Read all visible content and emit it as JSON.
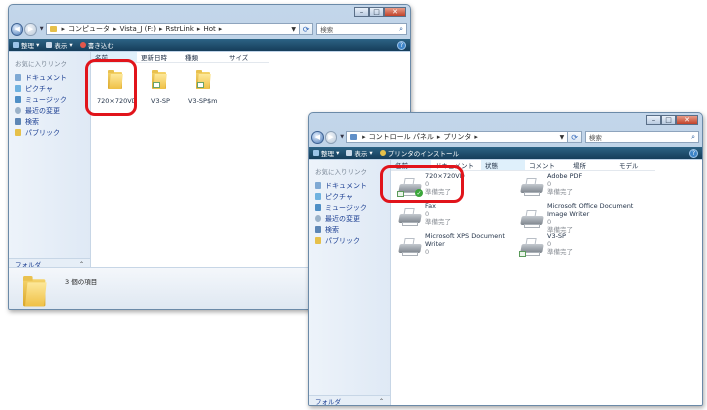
{
  "window1": {
    "breadcrumb": [
      "コンピュータ",
      "Vista_J (F:)",
      "RstrLink",
      "Hot"
    ],
    "search_placeholder": "検索",
    "toolbar": [
      "整理",
      "表示",
      "書き込む"
    ],
    "favorites_header": "お気に入りリンク",
    "favorites": [
      {
        "label": "ドキュメント",
        "icon": "documents-icon"
      },
      {
        "label": "ピクチャ",
        "icon": "pictures-icon"
      },
      {
        "label": "ミュージック",
        "icon": "music-icon"
      },
      {
        "label": "最近の変更",
        "icon": "recent-icon"
      },
      {
        "label": "検索",
        "icon": "search-folder-icon"
      },
      {
        "label": "パブリック",
        "icon": "public-folder-icon"
      }
    ],
    "folders_label": "フォルダ",
    "columns": [
      "名前",
      "更新日時",
      "種類",
      "サイズ"
    ],
    "items": [
      "720×720VD",
      "V3-SP",
      "V3-SP$m"
    ],
    "status": "3 個の項目",
    "accent": "#e1141b"
  },
  "window2": {
    "breadcrumb": [
      "コントロール パネル",
      "プリンタ"
    ],
    "search_placeholder": "検索",
    "toolbar": [
      "整理",
      "表示",
      "プリンタのインストール"
    ],
    "favorites_header": "お気に入りリンク",
    "favorites": [
      {
        "label": "ドキュメント",
        "icon": "documents-icon"
      },
      {
        "label": "ピクチャ",
        "icon": "pictures-icon"
      },
      {
        "label": "ミュージック",
        "icon": "music-icon"
      },
      {
        "label": "最近の変更",
        "icon": "recent-icon"
      },
      {
        "label": "検索",
        "icon": "search-folder-icon"
      },
      {
        "label": "パブリック",
        "icon": "public-folder-icon"
      }
    ],
    "folders_label": "フォルダ",
    "columns": [
      "名前",
      "ドキュメント",
      "状態",
      "コメント",
      "場所",
      "モデル"
    ],
    "printers": [
      {
        "name": "720×720VD",
        "line2": "",
        "count": "0",
        "status": "準備完了"
      },
      {
        "name": "Adobe PDF",
        "line2": "",
        "count": "0",
        "status": "準備完了"
      },
      {
        "name": "Fax",
        "line2": "",
        "count": "0",
        "status": "準備完了"
      },
      {
        "name": "Microsoft Office Document",
        "line2": "Image Writer",
        "count": "0",
        "status": "準備完了"
      },
      {
        "name": "Microsoft XPS Document",
        "line2": "Writer",
        "count": "0",
        "status": ""
      },
      {
        "name": "V3-SP",
        "line2": "",
        "count": "0",
        "status": "準備完了"
      }
    ]
  }
}
